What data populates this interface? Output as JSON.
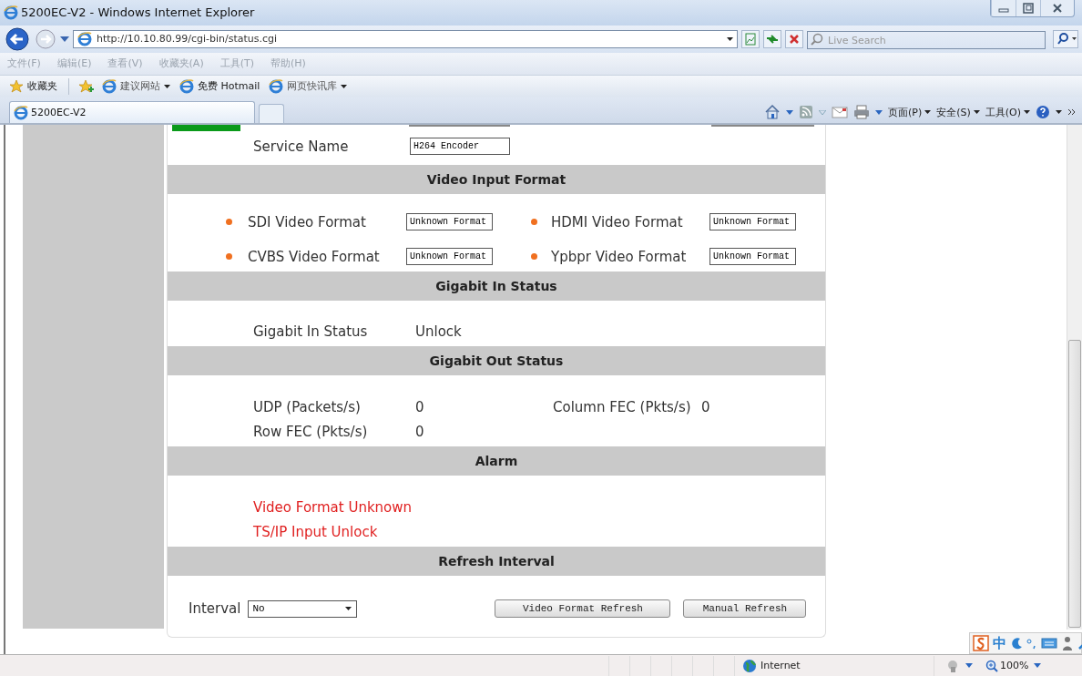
{
  "window": {
    "title": "5200EC-V2 - Windows Internet Explorer"
  },
  "address_bar": {
    "url": "http://10.10.80.99/cgi-bin/status.cgi"
  },
  "search": {
    "placeholder": "Live Search"
  },
  "menu": [
    "文件(F)",
    "编辑(E)",
    "查看(V)",
    "收藏夹(A)",
    "工具(T)",
    "帮助(H)"
  ],
  "favorites_bar": {
    "label": "收藏夹",
    "links": [
      {
        "label": "建议网站",
        "dropdown": true
      },
      {
        "label": "免费 Hotmail",
        "dropdown": false
      },
      {
        "label": "网页快讯库",
        "dropdown": true
      }
    ]
  },
  "tabs": [
    {
      "label": "5200EC-V2",
      "selected": true
    }
  ],
  "command_bar": [
    "页面(P)",
    "安全(S)",
    "工具(O)"
  ],
  "service_name": {
    "label": "Service Name",
    "value": "H264 Encoder"
  },
  "sections": [
    {
      "title": "Video Input Format",
      "kind": "fields",
      "items": [
        {
          "label": "SDI Video Format",
          "value": "Unknown Format"
        },
        {
          "label": "HDMI Video Format",
          "value": "Unknown Format"
        },
        {
          "label": "CVBS Video Format",
          "value": "Unknown Format"
        },
        {
          "label": "Ypbpr Video Format",
          "value": "Unknown Format"
        }
      ]
    },
    {
      "title": "Gigabit In Status",
      "kind": "readings",
      "items": [
        {
          "label": "Gigabit In Status",
          "value": "Unlock"
        }
      ]
    },
    {
      "title": "Gigabit Out Status",
      "kind": "readings",
      "items": [
        {
          "label": "UDP (Packets/s)",
          "value": "0"
        },
        {
          "label": "Column FEC (Pkts/s)",
          "value": "0"
        },
        {
          "label": "Row FEC (Pkts/s)",
          "value": "0"
        }
      ]
    },
    {
      "title": "Alarm",
      "kind": "alarms",
      "items": [
        "Video Format Unknown",
        "TS/IP Input Unlock"
      ]
    },
    {
      "title": "Refresh Interval",
      "kind": "refresh",
      "interval": {
        "label": "Interval",
        "value": "No"
      },
      "buttons": [
        "Video Format Refresh",
        "Manual Refresh"
      ]
    }
  ],
  "ime_bar": {
    "mode": "中"
  },
  "status_bar": {
    "zone": "Internet",
    "zoom": "100%"
  }
}
